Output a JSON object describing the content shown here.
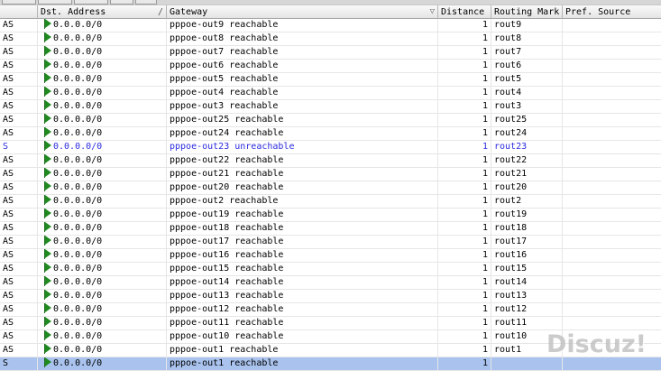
{
  "columns": {
    "flags": "",
    "dst": "Dst. Address",
    "gateway": "Gateway",
    "distance": "Distance",
    "mark": "Routing Mark",
    "pref": "Pref. Source"
  },
  "routes": [
    {
      "flags": "AS",
      "dst": "0.0.0.0/0",
      "gateway": "pppoe-out9 reachable",
      "distance": "1",
      "mark": "rout9",
      "pref": "",
      "state": "reachable"
    },
    {
      "flags": "AS",
      "dst": "0.0.0.0/0",
      "gateway": "pppoe-out8 reachable",
      "distance": "1",
      "mark": "rout8",
      "pref": "",
      "state": "reachable"
    },
    {
      "flags": "AS",
      "dst": "0.0.0.0/0",
      "gateway": "pppoe-out7 reachable",
      "distance": "1",
      "mark": "rout7",
      "pref": "",
      "state": "reachable"
    },
    {
      "flags": "AS",
      "dst": "0.0.0.0/0",
      "gateway": "pppoe-out6 reachable",
      "distance": "1",
      "mark": "rout6",
      "pref": "",
      "state": "reachable"
    },
    {
      "flags": "AS",
      "dst": "0.0.0.0/0",
      "gateway": "pppoe-out5 reachable",
      "distance": "1",
      "mark": "rout5",
      "pref": "",
      "state": "reachable"
    },
    {
      "flags": "AS",
      "dst": "0.0.0.0/0",
      "gateway": "pppoe-out4 reachable",
      "distance": "1",
      "mark": "rout4",
      "pref": "",
      "state": "reachable"
    },
    {
      "flags": "AS",
      "dst": "0.0.0.0/0",
      "gateway": "pppoe-out3 reachable",
      "distance": "1",
      "mark": "rout3",
      "pref": "",
      "state": "reachable"
    },
    {
      "flags": "AS",
      "dst": "0.0.0.0/0",
      "gateway": "pppoe-out25 reachable",
      "distance": "1",
      "mark": "rout25",
      "pref": "",
      "state": "reachable"
    },
    {
      "flags": "AS",
      "dst": "0.0.0.0/0",
      "gateway": "pppoe-out24 reachable",
      "distance": "1",
      "mark": "rout24",
      "pref": "",
      "state": "reachable"
    },
    {
      "flags": "S",
      "dst": "0.0.0.0/0",
      "gateway": "pppoe-out23 unreachable",
      "distance": "1",
      "mark": "rout23",
      "pref": "",
      "state": "unreachable"
    },
    {
      "flags": "AS",
      "dst": "0.0.0.0/0",
      "gateway": "pppoe-out22 reachable",
      "distance": "1",
      "mark": "rout22",
      "pref": "",
      "state": "reachable"
    },
    {
      "flags": "AS",
      "dst": "0.0.0.0/0",
      "gateway": "pppoe-out21 reachable",
      "distance": "1",
      "mark": "rout21",
      "pref": "",
      "state": "reachable"
    },
    {
      "flags": "AS",
      "dst": "0.0.0.0/0",
      "gateway": "pppoe-out20 reachable",
      "distance": "1",
      "mark": "rout20",
      "pref": "",
      "state": "reachable"
    },
    {
      "flags": "AS",
      "dst": "0.0.0.0/0",
      "gateway": "pppoe-out2 reachable",
      "distance": "1",
      "mark": "rout2",
      "pref": "",
      "state": "reachable"
    },
    {
      "flags": "AS",
      "dst": "0.0.0.0/0",
      "gateway": "pppoe-out19 reachable",
      "distance": "1",
      "mark": "rout19",
      "pref": "",
      "state": "reachable"
    },
    {
      "flags": "AS",
      "dst": "0.0.0.0/0",
      "gateway": "pppoe-out18 reachable",
      "distance": "1",
      "mark": "rout18",
      "pref": "",
      "state": "reachable"
    },
    {
      "flags": "AS",
      "dst": "0.0.0.0/0",
      "gateway": "pppoe-out17 reachable",
      "distance": "1",
      "mark": "rout17",
      "pref": "",
      "state": "reachable"
    },
    {
      "flags": "AS",
      "dst": "0.0.0.0/0",
      "gateway": "pppoe-out16 reachable",
      "distance": "1",
      "mark": "rout16",
      "pref": "",
      "state": "reachable"
    },
    {
      "flags": "AS",
      "dst": "0.0.0.0/0",
      "gateway": "pppoe-out15 reachable",
      "distance": "1",
      "mark": "rout15",
      "pref": "",
      "state": "reachable"
    },
    {
      "flags": "AS",
      "dst": "0.0.0.0/0",
      "gateway": "pppoe-out14 reachable",
      "distance": "1",
      "mark": "rout14",
      "pref": "",
      "state": "reachable"
    },
    {
      "flags": "AS",
      "dst": "0.0.0.0/0",
      "gateway": "pppoe-out13 reachable",
      "distance": "1",
      "mark": "rout13",
      "pref": "",
      "state": "reachable"
    },
    {
      "flags": "AS",
      "dst": "0.0.0.0/0",
      "gateway": "pppoe-out12 reachable",
      "distance": "1",
      "mark": "rout12",
      "pref": "",
      "state": "reachable"
    },
    {
      "flags": "AS",
      "dst": "0.0.0.0/0",
      "gateway": "pppoe-out11 reachable",
      "distance": "1",
      "mark": "rout11",
      "pref": "",
      "state": "reachable"
    },
    {
      "flags": "AS",
      "dst": "0.0.0.0/0",
      "gateway": "pppoe-out10 reachable",
      "distance": "1",
      "mark": "rout10",
      "pref": "",
      "state": "reachable"
    },
    {
      "flags": "AS",
      "dst": "0.0.0.0/0",
      "gateway": "pppoe-out1 reachable",
      "distance": "1",
      "mark": "rout1",
      "pref": "",
      "state": "reachable"
    },
    {
      "flags": "S",
      "dst": "0.0.0.0/0",
      "gateway": "pppoe-out1 reachable",
      "distance": "1",
      "mark": "",
      "pref": "",
      "state": "reachable",
      "selected": true
    }
  ],
  "colors": {
    "unreachable_text": "#2b2be0",
    "selected_row": "#a9c3ee",
    "route_icon": "#1f8a1f"
  },
  "icons": {
    "route": "green-flag-icon",
    "sort": "sort-indicator-icon",
    "filter": "filter-icon"
  },
  "watermark": "Discuz!"
}
